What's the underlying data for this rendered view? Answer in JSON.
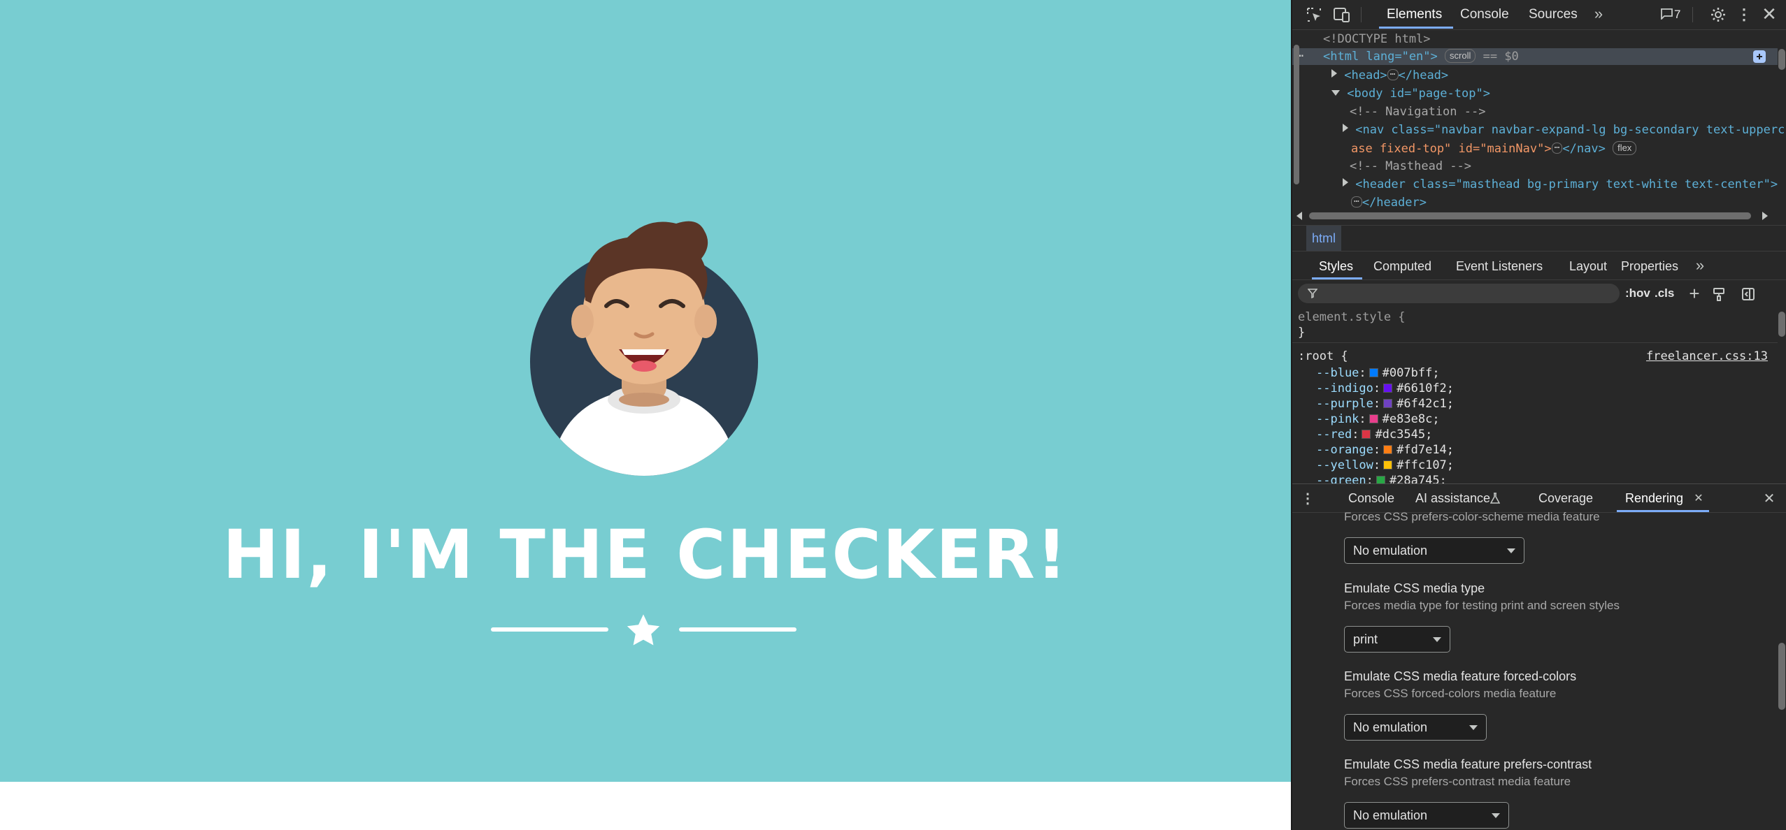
{
  "page": {
    "hero_title": "HI, I'M THE CHECKER!",
    "masthead_color": "#78cdd1",
    "avatar_icon": "smiling-man-avatar",
    "divider_icon": "star-icon"
  },
  "devtools": {
    "top_tabs": [
      "Elements",
      "Console",
      "Sources"
    ],
    "issues_count": "7",
    "dom": {
      "doctype": "<!DOCTYPE html>",
      "html_open": "<html lang=\"en\">",
      "scroll_badge": "scroll",
      "selected_marker": "== $0",
      "head": [
        "<head>",
        "</head>"
      ],
      "body_open": "<body id=\"page-top\">",
      "comment_nav": "<!-- Navigation -->",
      "nav_line1": "<nav class=\"navbar navbar-expand-lg bg-secondary text-upperc",
      "nav_line2": "ase fixed-top\" id=\"mainNav\">",
      "nav_close": "</nav>",
      "flex_badge": "flex",
      "comment_masthead": "<!-- Masthead -->",
      "header_open": "<header class=\"masthead bg-primary text-white text-center\">",
      "header_close": "</header>"
    },
    "breadcrumb": "html",
    "style_tabs": [
      "Styles",
      "Computed",
      "Event Listeners",
      "Layout",
      "Properties"
    ],
    "filter": {
      "hov": ":hov",
      "cls": ".cls"
    },
    "element_style": [
      "element.style {",
      "}"
    ],
    "root_rule": {
      "selector": ":root {",
      "source": "freelancer.css:13",
      "vars": [
        {
          "name": "--blue",
          "value": "#007bff;",
          "color": "#007bff"
        },
        {
          "name": "--indigo",
          "value": "#6610f2;",
          "color": "#6610f2"
        },
        {
          "name": "--purple",
          "value": "#6f42c1;",
          "color": "#6f42c1"
        },
        {
          "name": "--pink",
          "value": "#e83e8c;",
          "color": "#e83e8c"
        },
        {
          "name": "--red",
          "value": "#dc3545;",
          "color": "#dc3545"
        },
        {
          "name": "--orange",
          "value": "#fd7e14;",
          "color": "#fd7e14"
        },
        {
          "name": "--yellow",
          "value": "#ffc107;",
          "color": "#ffc107"
        },
        {
          "name": "--green",
          "value": "#28a745;",
          "color": "#28a745"
        }
      ]
    },
    "drawer_tabs": [
      "Console",
      "AI assistance",
      "Coverage",
      "Rendering"
    ],
    "rendering": {
      "cut_desc": "Forces CSS prefers-color-scheme media feature",
      "select1": "No emulation",
      "media_type_title": "Emulate CSS media type",
      "media_type_desc": "Forces media type for testing print and screen styles",
      "select2": "print",
      "forced_colors_title": "Emulate CSS media feature forced-colors",
      "forced_colors_desc": "Forces CSS forced-colors media feature",
      "select3": "No emulation",
      "contrast_title": "Emulate CSS media feature prefers-contrast",
      "contrast_desc": "Forces CSS prefers-contrast media feature",
      "select4": "No emulation"
    }
  }
}
